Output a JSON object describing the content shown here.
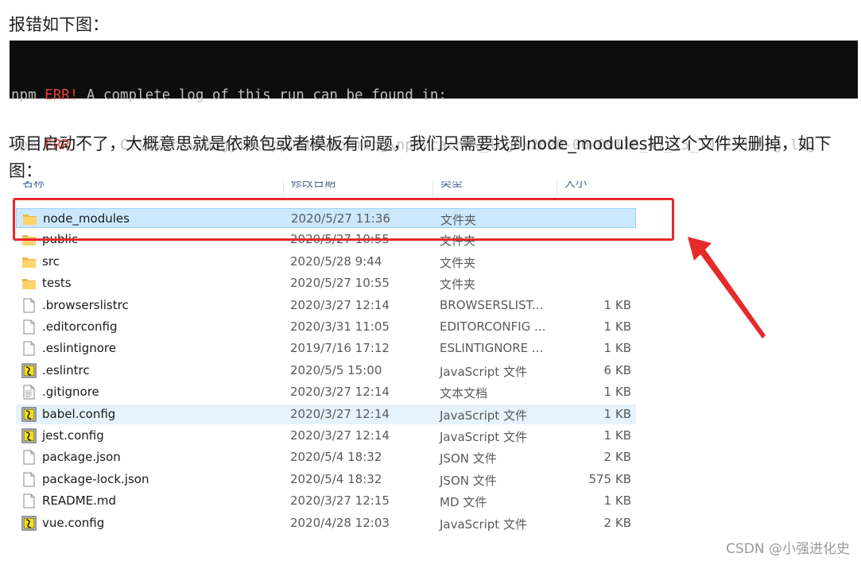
{
  "paragraphs": {
    "intro": "报错如下图：",
    "explain": "项目启动不了，大概意思就是依赖包或者模板有问题，我们只需要找到node_modules把这个文件夹删掉，如下图："
  },
  "console": {
    "lines": [
      {
        "prefix": "npm",
        "tag": "ERR!",
        "message": " A complete log of this run can be found in:"
      },
      {
        "prefix": "npm",
        "tag": "ERR!",
        "message": "     C:\\Users\\wangjie\\AppData\\Roaming\\npm-cache\\_logs\\2020-06-09T10_41_15_107Z-debug.log"
      }
    ],
    "colors": {
      "background": "#0c0c0c",
      "text": "#c0c0c0",
      "error": "#e0413a"
    }
  },
  "explorer": {
    "columns": [
      "名称",
      "修改日期",
      "类型",
      "大小"
    ],
    "files": [
      {
        "name": "node_modules",
        "date": "2020/5/27 11:36",
        "type": "文件夹",
        "size": "",
        "icon": "folder-icon",
        "state": "selected"
      },
      {
        "name": "public",
        "date": "2020/5/27 10:55",
        "type": "文件夹",
        "size": "",
        "icon": "folder-icon",
        "state": ""
      },
      {
        "name": "src",
        "date": "2020/5/28 9:44",
        "type": "文件夹",
        "size": "",
        "icon": "folder-icon",
        "state": ""
      },
      {
        "name": "tests",
        "date": "2020/5/27 10:55",
        "type": "文件夹",
        "size": "",
        "icon": "folder-icon",
        "state": ""
      },
      {
        "name": ".browserslistrc",
        "date": "2020/3/27 12:14",
        "type": "BROWSERSLIST...",
        "size": "1 KB",
        "icon": "file-icon",
        "state": ""
      },
      {
        "name": ".editorconfig",
        "date": "2020/3/31 11:05",
        "type": "EDITORCONFIG ...",
        "size": "1 KB",
        "icon": "file-icon",
        "state": ""
      },
      {
        "name": ".eslintignore",
        "date": "2019/7/16 17:12",
        "type": "ESLINTIGNORE ...",
        "size": "1 KB",
        "icon": "file-icon",
        "state": ""
      },
      {
        "name": ".eslintrc",
        "date": "2020/5/5 15:00",
        "type": "JavaScript 文件",
        "size": "6 KB",
        "icon": "javascript-file-icon",
        "state": ""
      },
      {
        "name": ".gitignore",
        "date": "2020/3/27 12:14",
        "type": "文本文档",
        "size": "1 KB",
        "icon": "text-file-icon",
        "state": ""
      },
      {
        "name": "babel.config",
        "date": "2020/3/27 12:14",
        "type": "JavaScript 文件",
        "size": "1 KB",
        "icon": "javascript-file-icon",
        "state": "hover"
      },
      {
        "name": "jest.config",
        "date": "2020/3/27 12:14",
        "type": "JavaScript 文件",
        "size": "1 KB",
        "icon": "javascript-file-icon",
        "state": ""
      },
      {
        "name": "package.json",
        "date": "2020/5/4 18:32",
        "type": "JSON 文件",
        "size": "2 KB",
        "icon": "file-icon",
        "state": ""
      },
      {
        "name": "package-lock.json",
        "date": "2020/5/4 18:32",
        "type": "JSON 文件",
        "size": "575 KB",
        "icon": "file-icon",
        "state": ""
      },
      {
        "name": "README.md",
        "date": "2020/3/27 12:15",
        "type": "MD 文件",
        "size": "1 KB",
        "icon": "file-icon",
        "state": ""
      },
      {
        "name": "vue.config",
        "date": "2020/4/28 12:03",
        "type": "JavaScript 文件",
        "size": "2 KB",
        "icon": "javascript-file-icon",
        "state": ""
      }
    ]
  },
  "annotation": {
    "icon": "red-arrow-icon",
    "color": "#e52a2a"
  },
  "watermark": "CSDN @小强进化史"
}
